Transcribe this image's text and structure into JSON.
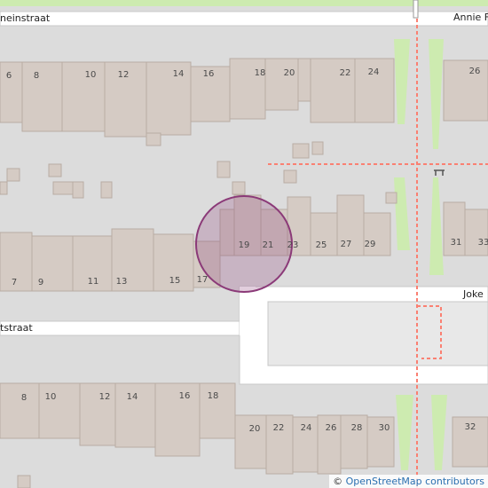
{
  "map": {
    "streets": [
      {
        "id": "top-street",
        "label": "neinstraat"
      },
      {
        "id": "top-right-street",
        "label": "Annie F"
      },
      {
        "id": "middle-left-street",
        "label": "tstraat"
      },
      {
        "id": "middle-right-street",
        "label": "Joke"
      }
    ],
    "house_numbers": {
      "row1": [
        "6",
        "8",
        "10",
        "12",
        "14",
        "16",
        "18",
        "20",
        "22",
        "24",
        "26"
      ],
      "row2": [
        "19",
        "21",
        "23",
        "25",
        "27",
        "29",
        "31",
        "33"
      ],
      "row2_left": [
        "7",
        "9",
        "11",
        "13",
        "15",
        "17"
      ],
      "row3": [
        "8",
        "10",
        "12",
        "14",
        "16",
        "18"
      ],
      "row4": [
        "20",
        "22",
        "24",
        "26",
        "28",
        "30",
        "32"
      ]
    },
    "marker": {
      "color": "#8b3a78"
    },
    "colors": {
      "background": "#dcdcdc",
      "building": "#d5cbc4",
      "building_stroke": "#b9aca3",
      "road": "#ffffff",
      "green": "#cdebb0",
      "footpath": "#fa8072"
    }
  },
  "attribution": {
    "symbol": "©",
    "text": "OpenStreetMap contributors"
  }
}
